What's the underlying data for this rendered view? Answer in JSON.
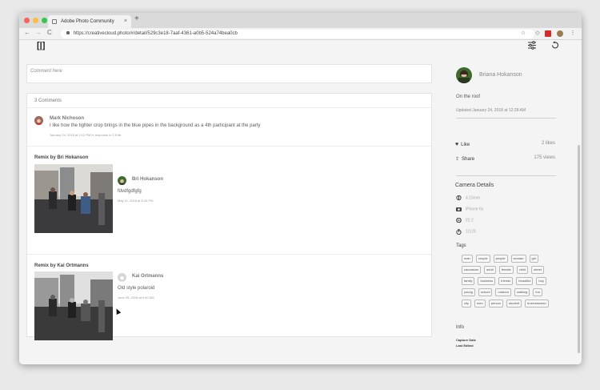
{
  "browser": {
    "tab_title": "Adobe Photo Community",
    "new_tab": "+",
    "url": "https://creativecloud.photo/#/detail/529c3e18-7aaf-4361-a0b5-524a74bea0cb",
    "back": "←",
    "forward": "→",
    "reload": "C",
    "more": "⋮",
    "close": "×"
  },
  "site": {
    "logo": "[|]"
  },
  "main": {
    "comment_placeholder": "Comment here",
    "comments_count": "3 Comments",
    "comment": {
      "author": "Mark Nichoson",
      "text": "I like how the tighter crop brings in the blue pipes in the background as a 4th participant at the party",
      "meta": "January 24, 2018 at 2:12 PM  in response to 2  Edit"
    },
    "remixes": [
      {
        "title": "Remix by Bri Hokanson",
        "author": "Bri Hokanson",
        "text": "fdvdfgdfgfg",
        "date": "May 11, 2018 at 8:10 PM"
      },
      {
        "title": "Remix by Kai Ortmanns",
        "author": "Kai Ortmanns",
        "text": "Old style polaroid",
        "date": "June 25, 2018 at 9:40 AM"
      }
    ]
  },
  "sidebar": {
    "owner": "Briana Hokanson",
    "photo_title": "On the roof",
    "updated": "Updated January 24, 2018 at 12:28 AM",
    "like_label": "Like",
    "likes": "2 likes",
    "share_label": "Share",
    "views": "175 views",
    "camera_heading": "Camera Details",
    "camera": [
      {
        "icon": "lens-icon",
        "value": "4.15mm"
      },
      {
        "icon": "camera-icon",
        "value": "iPhone 6s"
      },
      {
        "icon": "aperture-icon",
        "value": "f/2.2"
      },
      {
        "icon": "timer-icon",
        "value": "1/120"
      }
    ],
    "tags_heading": "Tags",
    "tags": [
      "man",
      "couple",
      "people",
      "woman",
      "girl",
      "caucasian",
      "adult",
      "female",
      "child",
      "street",
      "family",
      "business",
      "friends",
      "beautiful",
      "boy",
      "young",
      "school",
      "outdoor",
      "walking",
      "fun",
      "city",
      "men",
      "person",
      "student",
      "businessman"
    ],
    "info_heading": "Info",
    "capture_date_label": "Capture Date",
    "last_edited_label": "Last Edited"
  }
}
